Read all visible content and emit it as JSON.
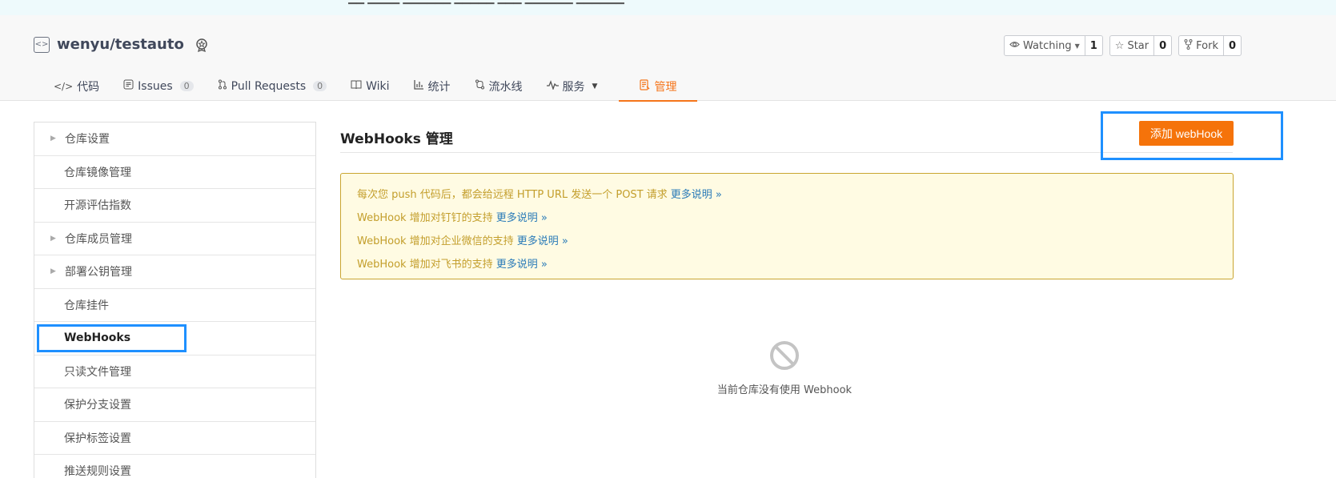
{
  "notice": {
    "text": "▁▁  ▁▁▁▁  ▁▁▁▁▁▁  ▁▁▁▁▁  ▁▁▁  ▁▁▁▁▁▁  ▁▁▁▁▁▁"
  },
  "repo": {
    "name": "wenyu/testauto",
    "icon": "repo-code-icon",
    "badge_icon": "medal-icon"
  },
  "actions": [
    {
      "label": "Watching",
      "count": "1",
      "icon": "eye-icon",
      "has_dropdown": true
    },
    {
      "label": "Star",
      "count": "0",
      "icon": "star-icon"
    },
    {
      "label": "Fork",
      "count": "0",
      "icon": "fork-icon"
    }
  ],
  "tabs": [
    {
      "label": "代码",
      "icon": "code-icon"
    },
    {
      "label": "Issues",
      "count": "0",
      "icon": "issues-icon"
    },
    {
      "label": "Pull Requests",
      "count": "0",
      "icon": "pull-request-icon"
    },
    {
      "label": "Wiki",
      "icon": "wiki-icon"
    },
    {
      "label": "统计",
      "icon": "chart-icon"
    },
    {
      "label": "流水线",
      "icon": "pipeline-icon"
    },
    {
      "label": "服务",
      "icon": "pulse-icon",
      "has_dropdown": true
    },
    {
      "label": "管理",
      "icon": "manage-icon",
      "active": true
    }
  ],
  "sidebar": {
    "items": [
      {
        "label": "仓库设置",
        "collapsible": true
      },
      {
        "label": "仓库镜像管理"
      },
      {
        "label": "开源评估指数"
      },
      {
        "label": "仓库成员管理",
        "collapsible": true
      },
      {
        "label": "部署公钥管理",
        "collapsible": true
      },
      {
        "label": "仓库挂件"
      },
      {
        "label": "WebHooks",
        "active": true
      },
      {
        "label": "只读文件管理"
      },
      {
        "label": "保护分支设置"
      },
      {
        "label": "保护标签设置"
      },
      {
        "label": "推送规则设置"
      }
    ]
  },
  "main": {
    "title": "WebHooks 管理",
    "add_button": "添加 webHook",
    "info_lines": [
      {
        "text": "每次您 push 代码后，都会给远程 HTTP URL 发送一个 POST 请求",
        "link": "更多说明 »"
      },
      {
        "text": "WebHook 增加对钉钉的支持",
        "link": "更多说明 »"
      },
      {
        "text": "WebHook 增加对企业微信的支持",
        "link": "更多说明 »"
      },
      {
        "text": "WebHook 增加对飞书的支持",
        "link": "更多说明 »"
      }
    ],
    "empty_text": "当前仓库没有使用 Webhook",
    "empty_icon": "ban-icon"
  },
  "colors": {
    "accent": "#f5751a",
    "highlight": "#1e90ff",
    "info_bg": "#fffbe3",
    "info_text": "#c39e2b",
    "link": "#2a7bb8"
  }
}
